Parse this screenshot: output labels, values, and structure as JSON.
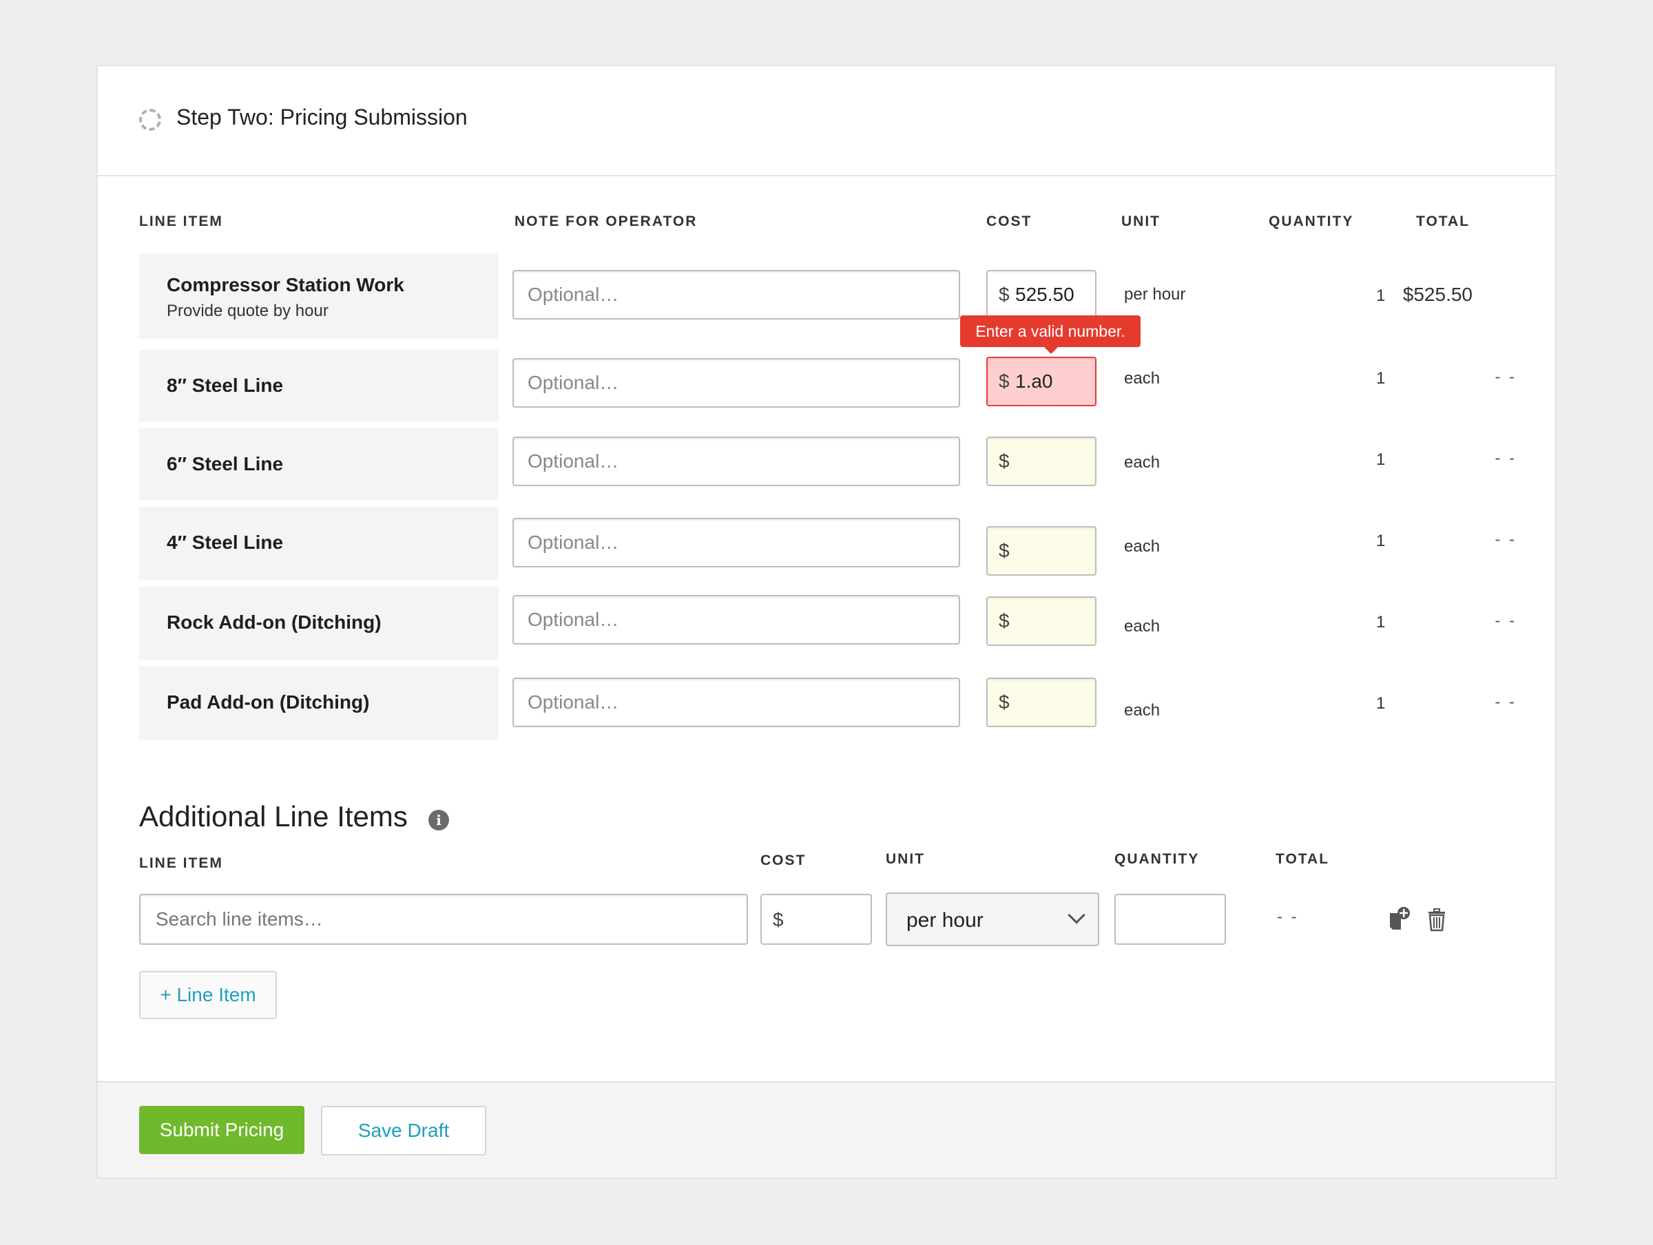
{
  "header": {
    "title": "Step Two: Pricing Submission"
  },
  "columns": {
    "line_item": "LINE ITEM",
    "note": "NOTE FOR OPERATOR",
    "cost": "COST",
    "unit": "UNIT",
    "quantity": "QUANTITY",
    "total": "TOTAL"
  },
  "note_placeholder": "Optional…",
  "currency_symbol": "$",
  "rows": [
    {
      "name": "Compressor Station Work",
      "sub": "Provide quote by hour",
      "cost": "525.50",
      "unit": "per hour",
      "qty": "1",
      "total": "$525.50"
    },
    {
      "name": "8″ Steel Line",
      "sub": "",
      "cost": "1.a0",
      "unit": "each",
      "qty": "1",
      "total": "- -"
    },
    {
      "name": "6″ Steel Line",
      "sub": "",
      "cost": "",
      "unit": "each",
      "qty": "1",
      "total": "- -"
    },
    {
      "name": "4″ Steel Line",
      "sub": "",
      "cost": "",
      "unit": "each",
      "qty": "1",
      "total": "- -"
    },
    {
      "name": "Rock Add-on (Ditching)",
      "sub": "",
      "cost": "",
      "unit": "each",
      "qty": "1",
      "total": "- -"
    },
    {
      "name": "Pad Add-on (Ditching)",
      "sub": "",
      "cost": "",
      "unit": "each",
      "qty": "1",
      "total": "- -"
    }
  ],
  "error_tooltip": "Enter a valid number.",
  "additional": {
    "title": "Additional Line Items",
    "info_glyph": "i",
    "columns": {
      "line_item": "LINE ITEM",
      "cost": "COST",
      "unit": "UNIT",
      "quantity": "QUANTITY",
      "total": "TOTAL"
    },
    "search_placeholder": "Search line items…",
    "unit_selected": "per hour",
    "total": "- -",
    "add_button": "+ Line Item"
  },
  "footer": {
    "submit": "Submit Pricing",
    "save": "Save Draft"
  },
  "colors": {
    "accent": "#1f9fbd",
    "submit": "#70b92c",
    "error": "#e53b2f",
    "error_bg": "#ffcfcf",
    "empty_bg": "#fdfce8"
  }
}
